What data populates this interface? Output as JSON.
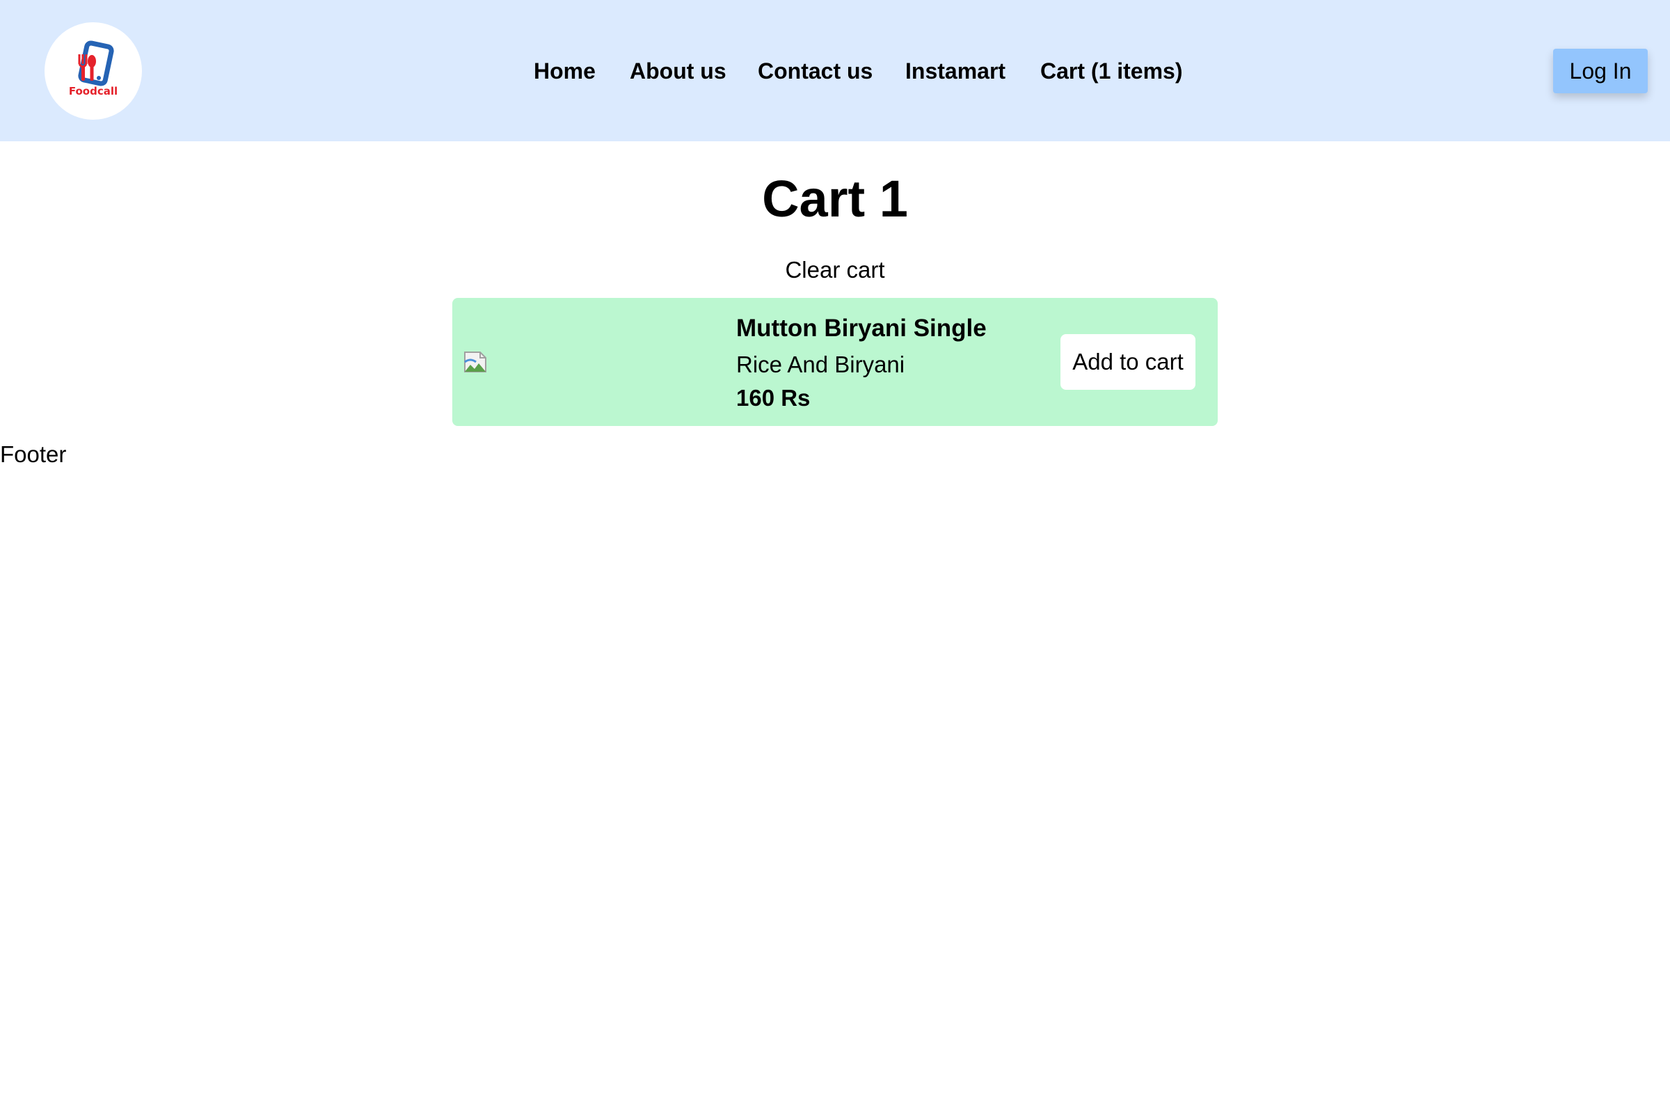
{
  "header": {
    "logo_text": "Foodcall",
    "nav": [
      {
        "label": "Home"
      },
      {
        "label": "About us"
      },
      {
        "label": "Contact us"
      },
      {
        "label": "Instamart"
      },
      {
        "label": "Cart (1 items)"
      }
    ],
    "login_label": "Log In"
  },
  "main": {
    "title": "Cart 1",
    "clear_cart_label": "Clear cart",
    "items": [
      {
        "name": "Mutton Biryani Single",
        "category": "Rice And Biryani",
        "price": "160 Rs",
        "add_label": "Add to cart",
        "image_icon": "broken-image-icon"
      }
    ]
  },
  "footer": {
    "label": "Footer"
  },
  "colors": {
    "header_bg": "#dbeafe",
    "login_bg": "#93c5fd",
    "card_bg": "#bbf7d0",
    "logo_red": "#e5222b",
    "logo_blue": "#2563b4"
  }
}
